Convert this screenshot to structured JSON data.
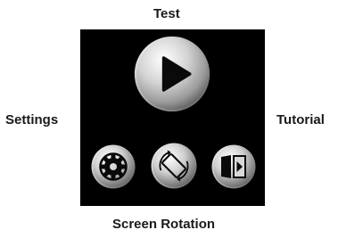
{
  "labels": {
    "test": "Test",
    "settings": "Settings",
    "tutorial": "Tutorial",
    "screen_rotation": "Screen Rotation"
  },
  "icons": {
    "play": "play-icon",
    "settings": "gear-icon",
    "rotation": "screen-rotation-icon",
    "tutorial": "book-play-icon"
  },
  "colors": {
    "screen_background": "#000000",
    "button_metal_light": "#f2f2f2",
    "button_metal_dark": "#6e6e6e",
    "icon_fill": "#0a0a0a"
  }
}
